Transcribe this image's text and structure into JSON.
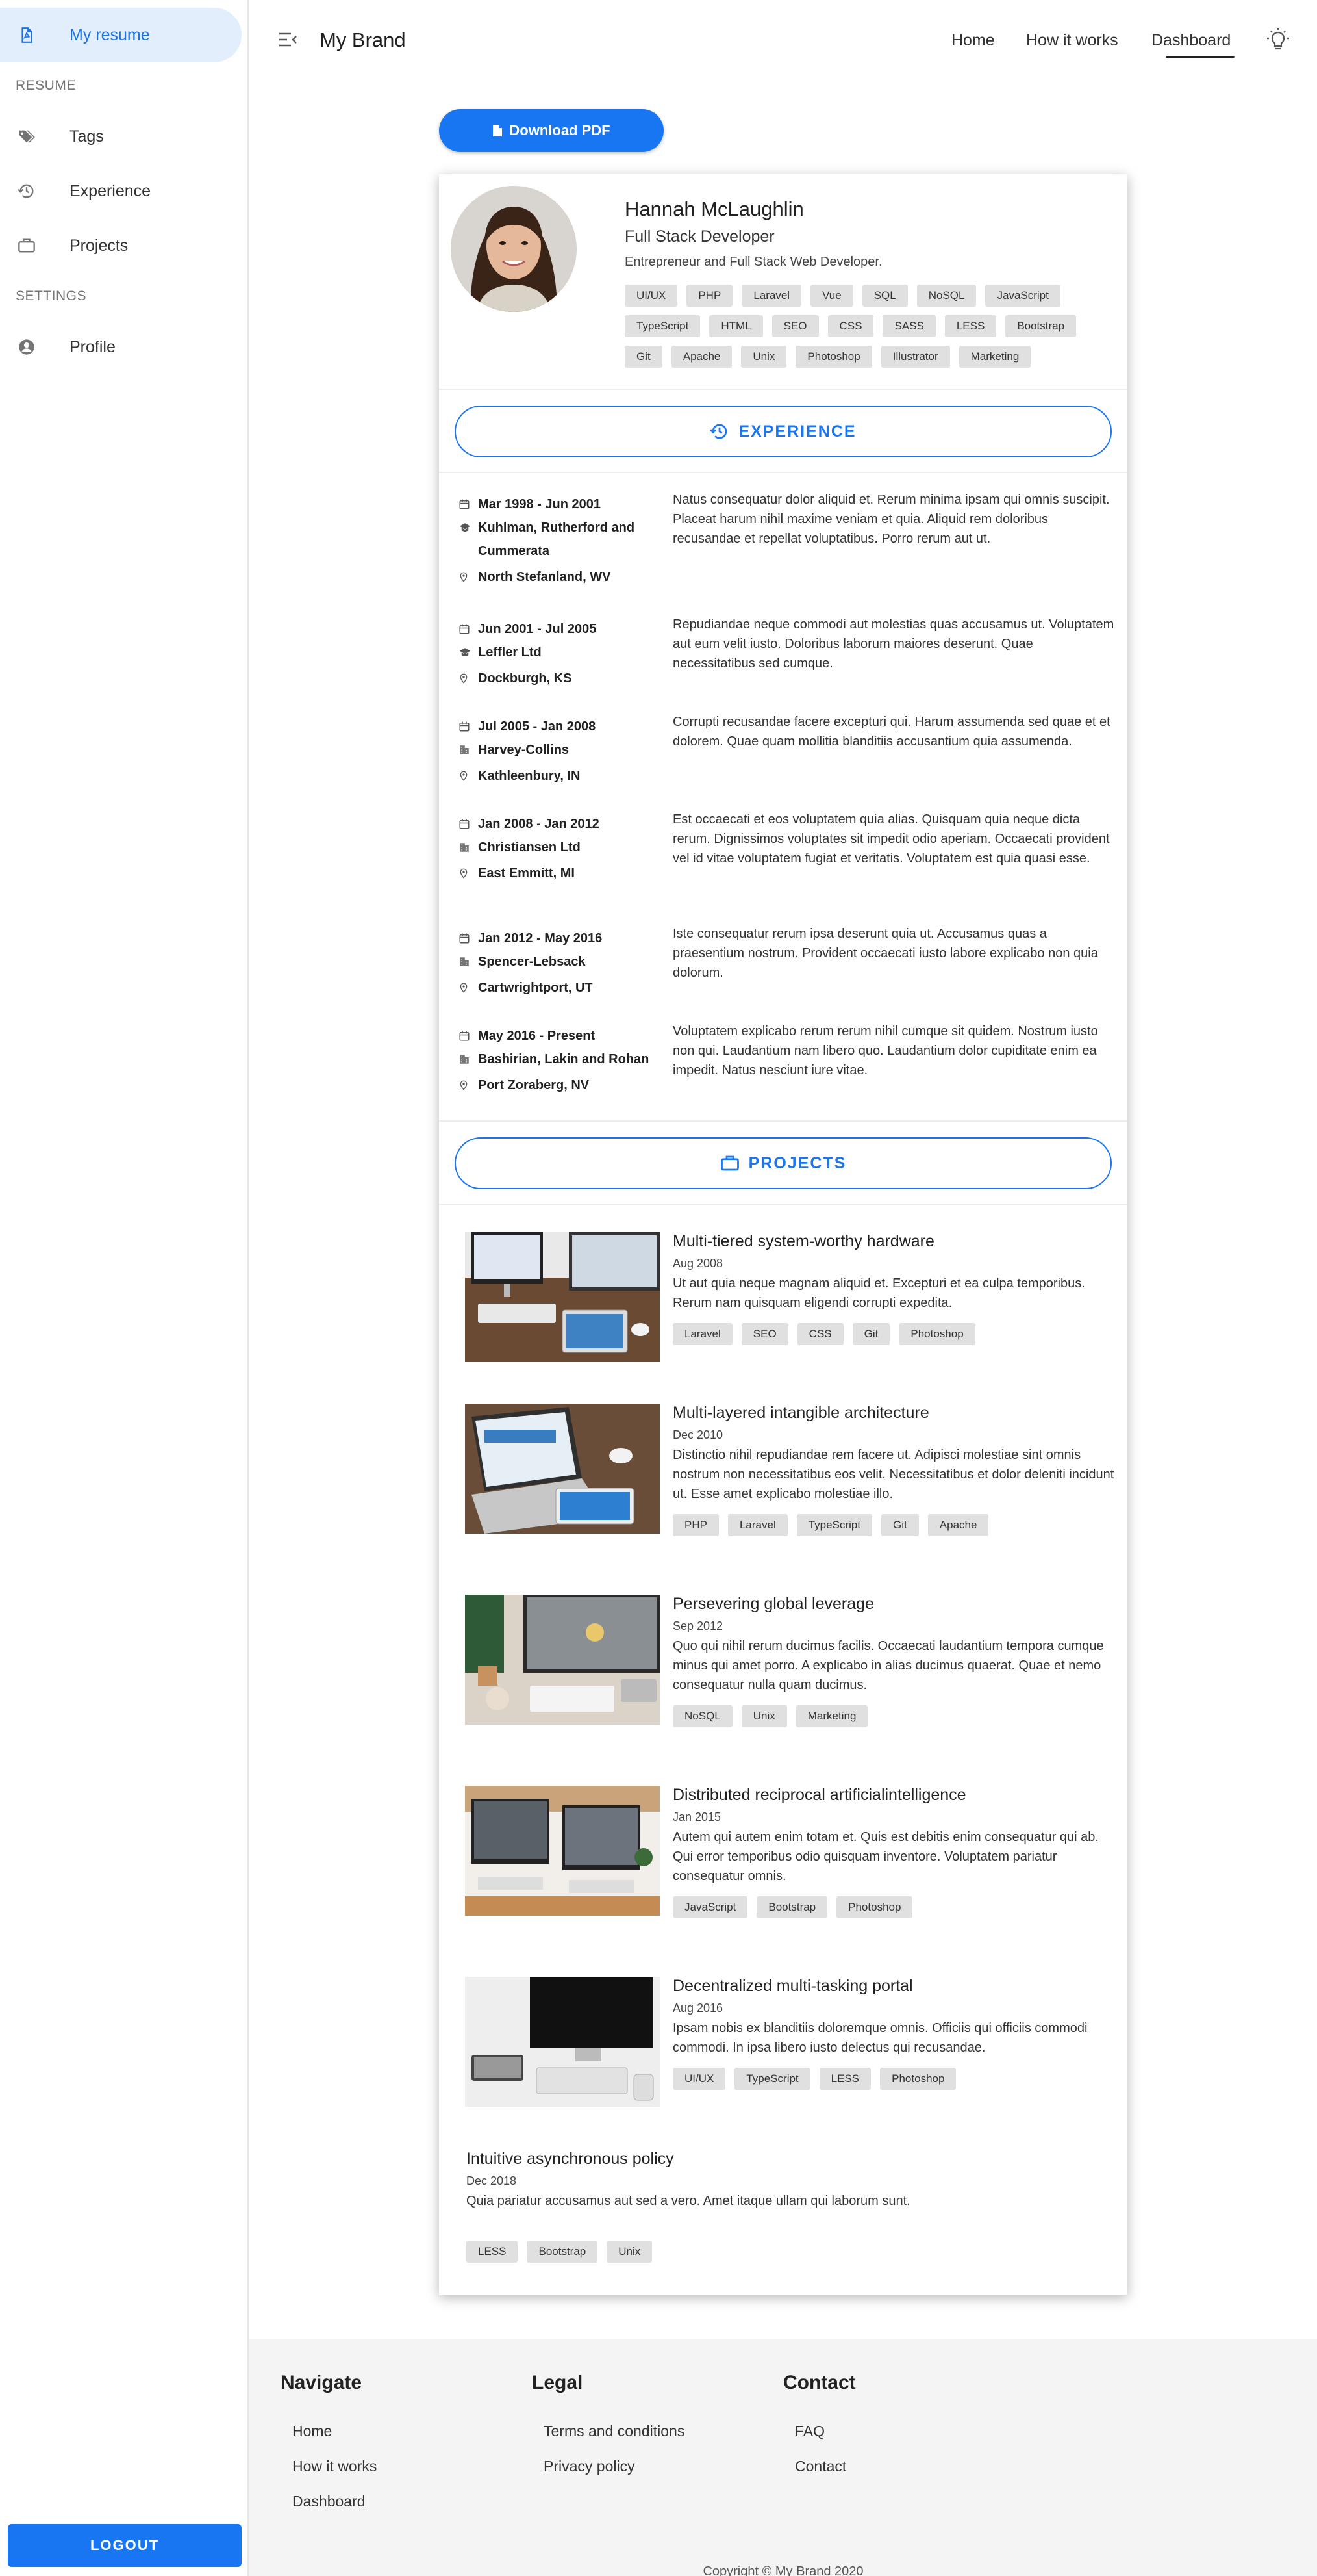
{
  "sidebar": {
    "top_item": {
      "label": "My resume",
      "icon": "pdf-file-icon"
    },
    "sections": [
      {
        "title": "RESUME",
        "items": [
          {
            "label": "Tags",
            "icon": "tags-icon"
          },
          {
            "label": "Experience",
            "icon": "history-icon"
          },
          {
            "label": "Projects",
            "icon": "briefcase-icon"
          }
        ]
      },
      {
        "title": "SETTINGS",
        "items": [
          {
            "label": "Profile",
            "icon": "account-circle-icon"
          }
        ]
      }
    ],
    "logout_label": "LOGOUT"
  },
  "header": {
    "brand": "My Brand",
    "nav": [
      "Home",
      "How it works",
      "Dashboard"
    ],
    "active_nav": "Dashboard"
  },
  "download_label": "Download PDF",
  "profile": {
    "name": "Hannah McLaughlin",
    "title": "Full Stack Developer",
    "description": "Entrepreneur and Full Stack Web Developer.",
    "skills": [
      "UI/UX",
      "PHP",
      "Laravel",
      "Vue",
      "SQL",
      "NoSQL",
      "JavaScript",
      "TypeScript",
      "HTML",
      "SEO",
      "CSS",
      "SASS",
      "LESS",
      "Bootstrap",
      "Git",
      "Apache",
      "Unix",
      "Photoshop",
      "Illustrator",
      "Marketing"
    ]
  },
  "experience_label": "EXPERIENCE",
  "experience": [
    {
      "dates": "Mar 1998 - Jun 2001",
      "company": "Kuhlman, Rutherford and Cummerata",
      "location": "North Stefanland, WV",
      "type": "school",
      "description": "Natus consequatur dolor aliquid et. Rerum minima ipsam qui omnis suscipit. Placeat harum nihil maxime veniam et quia. Aliquid rem doloribus recusandae et repellat voluptatibus. Porro rerum aut ut."
    },
    {
      "dates": "Jun 2001 - Jul 2005",
      "company": "Leffler Ltd",
      "location": "Dockburgh, KS",
      "type": "school",
      "description": "Repudiandae neque commodi aut molestias quas accusamus ut. Voluptatem aut eum velit iusto. Doloribus laborum maiores deserunt. Quae necessitatibus sed cumque."
    },
    {
      "dates": "Jul 2005 - Jan 2008",
      "company": "Harvey-Collins",
      "location": "Kathleenbury, IN",
      "type": "company",
      "description": "Corrupti recusandae facere excepturi qui. Harum assumenda sed quae et et dolorem. Quae quam mollitia blanditiis accusantium quia assumenda."
    },
    {
      "dates": "Jan 2008 - Jan 2012",
      "company": "Christiansen Ltd",
      "location": "East Emmitt, MI",
      "type": "company",
      "description": "Est occaecati et eos voluptatem quia alias. Quisquam quia neque dicta rerum. Dignissimos voluptates sit impedit odio aperiam. Occaecati provident vel id vitae voluptatem fugiat et veritatis. Voluptatem est quia quasi esse."
    },
    {
      "dates": "Jan 2012 - May 2016",
      "company": "Spencer-Lebsack",
      "location": "Cartwrightport, UT",
      "type": "company",
      "description": "Iste consequatur rerum ipsa deserunt quia ut. Accusamus quas a praesentium nostrum. Provident occaecati iusto labore explicabo non quia dolorum."
    },
    {
      "dates": "May 2016 - Present",
      "company": "Bashirian, Lakin and Rohan",
      "location": "Port Zoraberg, NV",
      "type": "company",
      "description": "Voluptatem explicabo rerum rerum nihil cumque sit quidem. Nostrum iusto non qui. Laudantium nam libero quo. Laudantium dolor cupiditate enim ea impedit. Natus nesciunt iure vitae."
    }
  ],
  "projects_label": "PROJECTS",
  "projects": [
    {
      "title": "Multi-tiered system-worthy hardware",
      "date": "Aug 2008",
      "description": "Ut aut quia neque magnam aliquid et. Excepturi et ea culpa temporibus. Rerum nam quisquam eligendi corrupti expedita.",
      "tags": [
        "Laravel",
        "SEO",
        "CSS",
        "Git",
        "Photoshop"
      ]
    },
    {
      "title": "Multi-layered intangible architecture",
      "date": "Dec 2010",
      "description": "Distinctio nihil repudiandae rem facere ut. Adipisci molestiae sint omnis nostrum non necessitatibus eos velit. Necessitatibus et dolor deleniti incidunt ut. Esse amet explicabo molestiae illo.",
      "tags": [
        "PHP",
        "Laravel",
        "TypeScript",
        "Git",
        "Apache"
      ]
    },
    {
      "title": "Persevering global leverage",
      "date": "Sep 2012",
      "description": "Quo qui nihil rerum ducimus facilis. Occaecati laudantium tempora cumque minus qui amet porro. A explicabo in alias ducimus quaerat. Quae et nemo consequatur nulla quam ducimus.",
      "tags": [
        "NoSQL",
        "Unix",
        "Marketing"
      ]
    },
    {
      "title": "Distributed reciprocal artificialintelligence",
      "date": "Jan 2015",
      "description": "Autem qui autem enim totam et. Quis est debitis enim consequatur qui ab. Qui error temporibus odio quisquam inventore. Voluptatem pariatur consequatur omnis.",
      "tags": [
        "JavaScript",
        "Bootstrap",
        "Photoshop"
      ]
    },
    {
      "title": "Decentralized multi-tasking portal",
      "date": "Aug 2016",
      "description": "Ipsam nobis ex blanditiis doloremque omnis. Officiis qui officiis commodi commodi. In ipsa libero iusto delectus qui recusandae.",
      "tags": [
        "UI/UX",
        "TypeScript",
        "LESS",
        "Photoshop"
      ]
    },
    {
      "title": "Intuitive asynchronous policy",
      "date": "Dec 2018",
      "description": "Quia pariatur accusamus aut sed a vero. Amet itaque ullam qui laborum sunt.",
      "tags": [
        "LESS",
        "Bootstrap",
        "Unix"
      ]
    }
  ],
  "footer": {
    "columns": [
      {
        "title": "Navigate",
        "links": [
          "Home",
          "How it works",
          "Dashboard"
        ]
      },
      {
        "title": "Legal",
        "links": [
          "Terms and conditions",
          "Privacy policy"
        ]
      },
      {
        "title": "Contact",
        "links": [
          "FAQ",
          "Contact"
        ]
      }
    ],
    "copyright": "Copyright © My Brand 2020"
  },
  "colors": {
    "accent": "#1976f2",
    "active_bg": "#e3eefc",
    "chip_bg": "#e0e0e0",
    "footer_bg": "#f4f4f4"
  }
}
